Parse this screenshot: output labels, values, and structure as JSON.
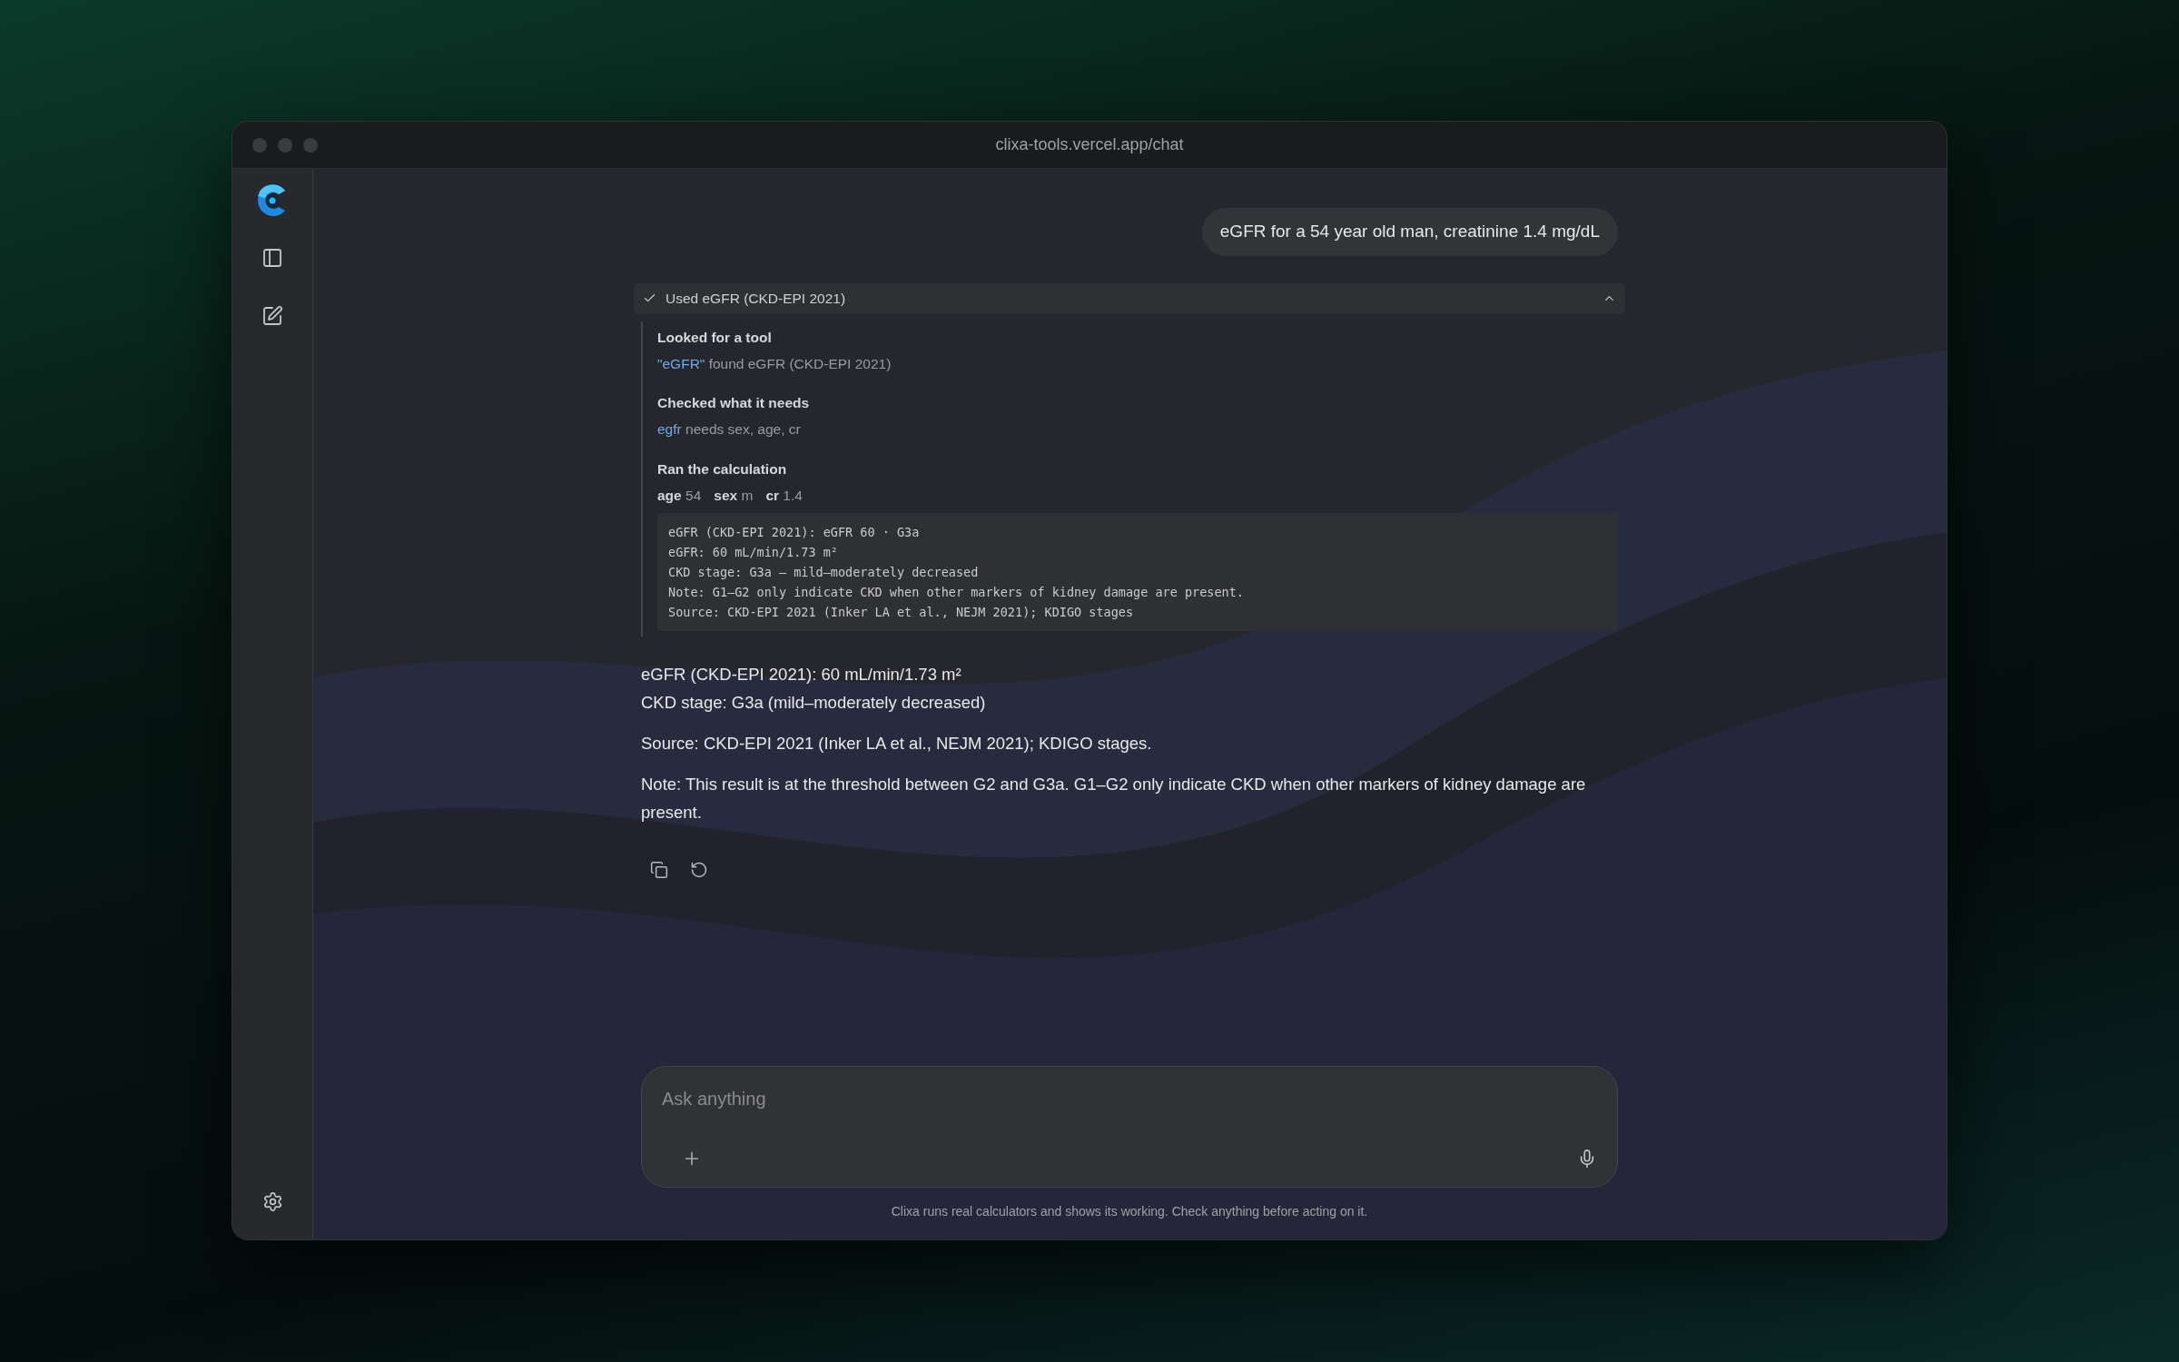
{
  "window": {
    "title": "clixa-tools.vercel.app/chat"
  },
  "conversation": {
    "user_message": "eGFR for a 54 year old man, creatinine 1.4 mg/dL",
    "tool_call": {
      "label": "Used eGFR (CKD-EPI 2021)",
      "expanded": true,
      "steps": [
        {
          "kind": "search",
          "title": "Looked for a tool",
          "highlight": "\"eGFR\"",
          "detail": "found eGFR (CKD-EPI 2021)"
        },
        {
          "kind": "check",
          "title": "Checked what it needs",
          "highlight": "egfr",
          "detail": "needs sex, age, cr"
        },
        {
          "kind": "run",
          "title": "Ran the calculation",
          "params": [
            {
              "name": "age",
              "value": "54"
            },
            {
              "name": "sex",
              "value": "m"
            },
            {
              "name": "cr",
              "value": "1.4"
            }
          ],
          "output": [
            "eGFR (CKD-EPI 2021): eGFR 60 · G3a",
            "eGFR: 60 mL/min/1.73 m²",
            "CKD stage: G3a — mild–moderately decreased",
            "Note: G1–G2 only indicate CKD when other markers of kidney damage are present.",
            "Source: CKD-EPI 2021 (Inker LA et al., NEJM 2021); KDIGO stages"
          ]
        }
      ]
    },
    "answer": [
      [
        "eGFR (CKD-EPI 2021): 60 mL/min/1.73 m²",
        "CKD stage: G3a (mild–moderately decreased)"
      ],
      [
        "Source: CKD-EPI 2021 (Inker LA et al., NEJM 2021); KDIGO stages."
      ],
      [
        "Note: This result is at the threshold between G2 and G3a. G1–G2 only indicate CKD when other markers of kidney damage are present."
      ]
    ]
  },
  "composer": {
    "placeholder": "Ask anything"
  },
  "disclaimer": "Clixa runs real calculators and shows its working. Check anything before acting on it."
}
